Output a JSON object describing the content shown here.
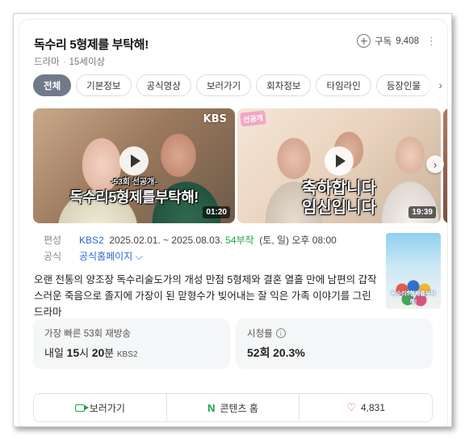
{
  "header": {
    "title": "독수리 5형제를 부탁해!",
    "genre": "드라마",
    "rating": "15세이상",
    "subscribe_label": "구독",
    "subscribe_count": "9,408"
  },
  "tabs": [
    {
      "label": "전체",
      "active": true
    },
    {
      "label": "기본정보"
    },
    {
      "label": "공식영상"
    },
    {
      "label": "보러가기"
    },
    {
      "label": "회차정보"
    },
    {
      "label": "타임라인"
    },
    {
      "label": "등장인물"
    },
    {
      "label": ""
    }
  ],
  "videos": [
    {
      "logo": "KBS",
      "subtitle": "-53회 선공개-",
      "caption": "독수리5형제를부탁해!",
      "duration": "01:20"
    },
    {
      "badge": "선공개",
      "caption_line1": "축하합니다",
      "caption_line2": "임신입니다",
      "duration": "19:39"
    }
  ],
  "info": {
    "broadcast_label": "편성",
    "channel": "KBS2",
    "dates": "2025.02.01. ~ 2025.08.03.",
    "episodes": "54부작",
    "schedule": "(토, 일) 오후 08:00",
    "official_label": "공식",
    "homepage_label": "공식홈페이지",
    "homepage_chevron": "⌵"
  },
  "poster_title": "독수리5형제를부탁해!",
  "description": "오랜 전통의 양조장 독수리술도가의 개성 만점 5형제와 결혼 열흘 만에 남편의 갑작스러운 죽음으로 졸지에 가장이 된 맏형수가 빚어내는 잘 익은 가족 이야기를 그린 드라마",
  "stats": {
    "rerun_label": "가장 빠른 53회 재방송",
    "rerun_day": "내일",
    "rerun_hour": "15",
    "rerun_hour_unit": "시",
    "rerun_min": "20",
    "rerun_min_unit": "분",
    "rerun_channel": "KBS2",
    "ratings_label": "시청률",
    "ratings_episode": "52회",
    "ratings_value": "20.3%"
  },
  "bottom": {
    "watch_label": "보러가기",
    "content_home_label": "콘텐츠 홈",
    "likes": "4,831"
  },
  "colors": {
    "accent_blue": "#2c66d8",
    "accent_green": "#1aa44a",
    "active_tab": "#6f7b8b",
    "heart": "#e8475c"
  }
}
